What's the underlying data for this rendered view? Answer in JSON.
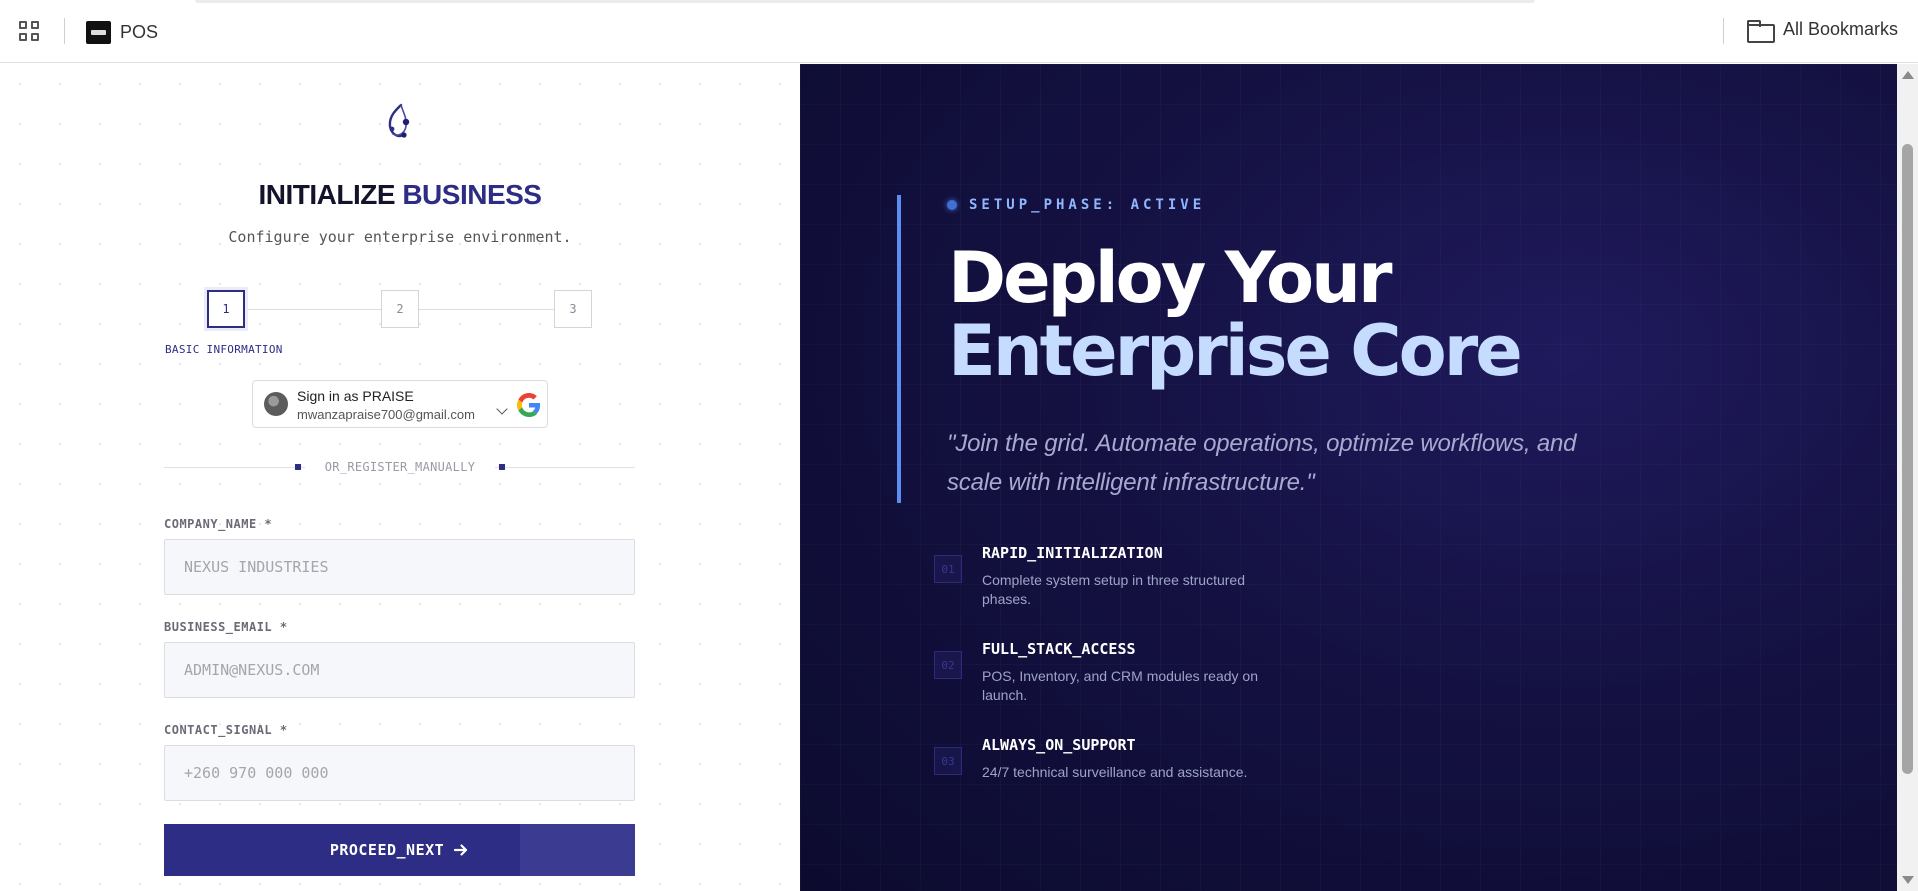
{
  "bookmarks_bar": {
    "apps_icon": "apps-grid-icon",
    "pos_label": "POS",
    "all_bookmarks_label": "All Bookmarks"
  },
  "form": {
    "title_part1": "INITIALIZE",
    "title_part2": "BUSINESS",
    "subtitle": "Configure your enterprise environment.",
    "steps": [
      "1",
      "2",
      "3"
    ],
    "active_step_label": "BASIC INFORMATION",
    "google_signin": {
      "name": "Sign in as PRAISE",
      "email": "mwanzapraise700@gmail.com"
    },
    "divider_text": "OR_REGISTER_MANUALLY",
    "fields": {
      "company": {
        "label": "COMPANY_NAME *",
        "placeholder": "NEXUS INDUSTRIES"
      },
      "email": {
        "label": "BUSINESS_EMAIL *",
        "placeholder": "ADMIN@NEXUS.COM"
      },
      "contact": {
        "label": "CONTACT_SIGNAL *",
        "placeholder": "+260 970 000 000"
      }
    },
    "proceed_label": "PROCEED_NEXT"
  },
  "hero": {
    "phase": "SETUP_PHASE: ACTIVE",
    "headline_line1": "Deploy Your",
    "headline_line2": "Enterprise Core",
    "quote": "\"Join the grid. Automate operations, optimize workflows, and scale with intelligent infrastructure.\"",
    "features": [
      {
        "num": "01",
        "title": "RAPID_INITIALIZATION",
        "desc": "Complete system setup in three structured phases."
      },
      {
        "num": "02",
        "title": "FULL_STACK_ACCESS",
        "desc": "POS, Inventory, and CRM modules ready on launch."
      },
      {
        "num": "03",
        "title": "ALWAYS_ON_SUPPORT",
        "desc": "24/7 technical surveillance and assistance."
      }
    ]
  },
  "colors": {
    "brand": "#2d2d86",
    "hero_bg": "#141142",
    "accent_blue": "#5b8ef0",
    "headline_light": "#c5dcff"
  }
}
